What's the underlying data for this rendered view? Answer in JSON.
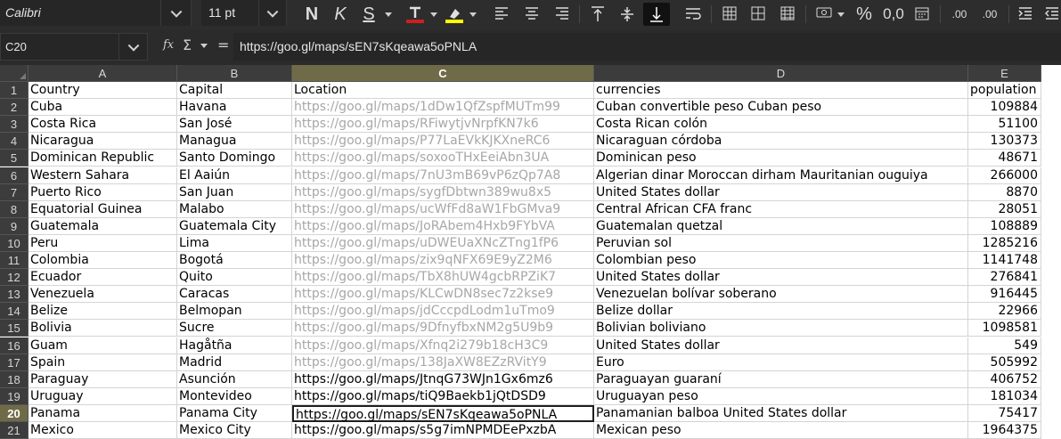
{
  "toolbar": {
    "font_name": "Calibri",
    "font_size": "11 pt",
    "bold_label": "N",
    "italic_label": "K",
    "underline_label": "S",
    "percent_label": "%",
    "decimal_label": "0,0",
    "add_decimal_label": ".00",
    "remove_decimal_label": ".00",
    "accent_color": "#c9211e",
    "highlight_color": "#ffff00"
  },
  "formula_bar": {
    "cell_ref": "C20",
    "fx_label": "fx",
    "sum_label": "Σ",
    "equals_label": "=",
    "content": "https://goo.gl/maps/sEN7sKqeawa5oPNLA"
  },
  "sheet": {
    "selected_column": "C",
    "selected_row": "20",
    "columns": [
      "A",
      "B",
      "C",
      "D",
      "E"
    ],
    "rows": [
      {
        "n": "1",
        "country": "Country",
        "capital": "Capital",
        "location": "Location",
        "currencies": "currencies",
        "population": "population"
      },
      {
        "n": "2",
        "country": "Cuba",
        "capital": "Havana",
        "location": "https://goo.gl/maps/1dDw1QfZspfMUTm99",
        "currencies": "Cuban convertible peso Cuban peso",
        "population": "109884"
      },
      {
        "n": "3",
        "country": "Costa Rica",
        "capital": "San José",
        "location": "https://goo.gl/maps/RFiwytjvNrpfKN7k6",
        "currencies": "Costa Rican colón",
        "population": "51100"
      },
      {
        "n": "4",
        "country": "Nicaragua",
        "capital": "Managua",
        "location": "https://goo.gl/maps/P77LaEVkKJKXneRC6",
        "currencies": "Nicaraguan córdoba",
        "population": "130373"
      },
      {
        "n": "5",
        "country": "Dominican Republic",
        "capital": "Santo Domingo",
        "location": "https://goo.gl/maps/soxooTHxEeiAbn3UA",
        "currencies": "Dominican peso",
        "population": "48671"
      },
      {
        "n": "6",
        "country": "Western Sahara",
        "capital": "El Aaiún",
        "location": "https://goo.gl/maps/7nU3mB69vP6zQp7A8",
        "currencies": "Algerian dinar Moroccan dirham Mauritanian ouguiya",
        "population": "266000"
      },
      {
        "n": "7",
        "country": "Puerto Rico",
        "capital": "San Juan",
        "location": "https://goo.gl/maps/sygfDbtwn389wu8x5",
        "currencies": "United States dollar",
        "population": "8870"
      },
      {
        "n": "8",
        "country": "Equatorial Guinea",
        "capital": "Malabo",
        "location": "https://goo.gl/maps/ucWfFd8aW1FbGMva9",
        "currencies": "Central African CFA franc",
        "population": "28051"
      },
      {
        "n": "9",
        "country": "Guatemala",
        "capital": "Guatemala City",
        "location": "https://goo.gl/maps/JoRAbem4Hxb9FYbVA",
        "currencies": "Guatemalan quetzal",
        "population": "108889"
      },
      {
        "n": "10",
        "country": "Peru",
        "capital": "Lima",
        "location": "https://goo.gl/maps/uDWEUaXNcZTng1fP6",
        "currencies": "Peruvian sol",
        "population": "1285216"
      },
      {
        "n": "11",
        "country": "Colombia",
        "capital": "Bogotá",
        "location": "https://goo.gl/maps/zix9qNFX69E9yZ2M6",
        "currencies": "Colombian peso",
        "population": "1141748"
      },
      {
        "n": "12",
        "country": "Ecuador",
        "capital": "Quito",
        "location": "https://goo.gl/maps/TbX8hUW4gcbRPZiK7",
        "currencies": "United States dollar",
        "population": "276841"
      },
      {
        "n": "13",
        "country": "Venezuela",
        "capital": "Caracas",
        "location": "https://goo.gl/maps/KLCwDN8sec7z2kse9",
        "currencies": "Venezuelan bolívar soberano",
        "population": "916445"
      },
      {
        "n": "14",
        "country": "Belize",
        "capital": "Belmopan",
        "location": "https://goo.gl/maps/jdCccpdLodm1uTmo9",
        "currencies": "Belize dollar",
        "population": "22966"
      },
      {
        "n": "15",
        "country": "Bolivia",
        "capital": "Sucre",
        "location": "https://goo.gl/maps/9DfnyfbxNM2g5U9b9",
        "currencies": "Bolivian boliviano",
        "population": "1098581"
      },
      {
        "n": "16",
        "country": "Guam",
        "capital": "Hagåtña",
        "location": "https://goo.gl/maps/Xfnq2i279b18cH3C9",
        "currencies": "United States dollar",
        "population": "549"
      },
      {
        "n": "17",
        "country": "Spain",
        "capital": "Madrid",
        "location": "https://goo.gl/maps/138JaXW8EZzRVitY9",
        "currencies": "Euro",
        "population": "505992"
      },
      {
        "n": "18",
        "country": "Paraguay",
        "capital": "Asunción",
        "location": "https://goo.gl/maps/JtnqG73WJn1Gx6mz6",
        "currencies": "Paraguayan guaraní",
        "population": "406752"
      },
      {
        "n": "19",
        "country": "Uruguay",
        "capital": "Montevideo",
        "location": "https://goo.gl/maps/tiQ9Baekb1jQtDSD9",
        "currencies": "Uruguayan peso",
        "population": "181034"
      },
      {
        "n": "20",
        "country": "Panama",
        "capital": "Panama City",
        "location": "https://goo.gl/maps/sEN7sKqeawa5oPNLA",
        "currencies": "Panamanian balboa United States dollar",
        "population": "75417"
      },
      {
        "n": "21",
        "country": "Mexico",
        "capital": "Mexico City",
        "location": "https://goo.gl/maps/s5g7imNPMDEePxzbA",
        "currencies": "Mexican peso",
        "population": "1964375"
      }
    ],
    "visited_link_rows": [
      "2",
      "3",
      "4",
      "5",
      "6",
      "7",
      "8",
      "9",
      "10",
      "11",
      "12",
      "13",
      "14",
      "15",
      "16",
      "17"
    ]
  }
}
